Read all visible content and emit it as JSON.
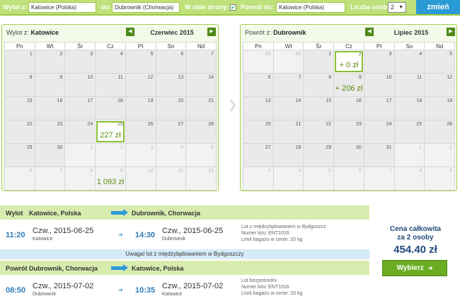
{
  "search": {
    "from_label": "Wylot z:",
    "from_value": "Katowice (Polska)",
    "to_label": "do:",
    "to_value": "Dubrownik (Chorwacja)",
    "roundtrip_label": "W obie strony:",
    "return_label": "Powrót do:",
    "return_value": "Katowice (Polska)",
    "persons_label": "Liczba osób:",
    "persons_value": "2",
    "submit_label": "zmień"
  },
  "outbound_calendar": {
    "title_prefix": "Wylot z:",
    "city": "Katowice",
    "month": "Czerwiec 2015",
    "weekdays": [
      "Pn",
      "Wt",
      "Śr",
      "Cz",
      "Pt",
      "So",
      "Nd"
    ],
    "weeks": [
      [
        {
          "d": "1"
        },
        {
          "d": "2"
        },
        {
          "d": "3"
        },
        {
          "d": "4"
        },
        {
          "d": "5"
        },
        {
          "d": "6"
        },
        {
          "d": "7"
        }
      ],
      [
        {
          "d": "8"
        },
        {
          "d": "9"
        },
        {
          "d": "10"
        },
        {
          "d": "11"
        },
        {
          "d": "12"
        },
        {
          "d": "13"
        },
        {
          "d": "14"
        }
      ],
      [
        {
          "d": "15"
        },
        {
          "d": "16"
        },
        {
          "d": "17"
        },
        {
          "d": "18"
        },
        {
          "d": "19"
        },
        {
          "d": "20"
        },
        {
          "d": "21"
        }
      ],
      [
        {
          "d": "22"
        },
        {
          "d": "23"
        },
        {
          "d": "24"
        },
        {
          "d": "25",
          "price": "227 zł",
          "sel": true
        },
        {
          "d": "26"
        },
        {
          "d": "27"
        },
        {
          "d": "28"
        }
      ],
      [
        {
          "d": "29"
        },
        {
          "d": "30"
        },
        {
          "d": "1",
          "out": true
        },
        {
          "d": "2",
          "out": true
        },
        {
          "d": "3",
          "out": true
        },
        {
          "d": "4",
          "out": true
        },
        {
          "d": "5",
          "out": true
        }
      ],
      [
        {
          "d": "6",
          "out": true
        },
        {
          "d": "7",
          "out": true
        },
        {
          "d": "8",
          "out": true
        },
        {
          "d": "9",
          "out": true,
          "price": "1 093 zł"
        },
        {
          "d": "10",
          "out": true
        },
        {
          "d": "11",
          "out": true
        },
        {
          "d": "12",
          "out": true
        }
      ]
    ]
  },
  "return_calendar": {
    "title_prefix": "Powrót z:",
    "city": "Dubrownik",
    "month": "Lipiec 2015",
    "weekdays": [
      "Pn",
      "Wt",
      "Śr",
      "Cz",
      "Pt",
      "So",
      "Nd"
    ],
    "weeks": [
      [
        {
          "d": "29",
          "out": true
        },
        {
          "d": "30",
          "out": true
        },
        {
          "d": "1"
        },
        {
          "d": "2",
          "price": "+ 0 zł",
          "sel": true
        },
        {
          "d": "3"
        },
        {
          "d": "4"
        },
        {
          "d": "5"
        }
      ],
      [
        {
          "d": "6"
        },
        {
          "d": "7"
        },
        {
          "d": "8"
        },
        {
          "d": "9",
          "price": "+ 206 zł"
        },
        {
          "d": "10"
        },
        {
          "d": "11"
        },
        {
          "d": "12"
        }
      ],
      [
        {
          "d": "13"
        },
        {
          "d": "14"
        },
        {
          "d": "15"
        },
        {
          "d": "16"
        },
        {
          "d": "17"
        },
        {
          "d": "18"
        },
        {
          "d": "19"
        }
      ],
      [
        {
          "d": "20"
        },
        {
          "d": "21"
        },
        {
          "d": "22"
        },
        {
          "d": "23"
        },
        {
          "d": "24"
        },
        {
          "d": "25"
        },
        {
          "d": "26"
        }
      ],
      [
        {
          "d": "27"
        },
        {
          "d": "28"
        },
        {
          "d": "29"
        },
        {
          "d": "30"
        },
        {
          "d": "31"
        },
        {
          "d": "1",
          "out": true
        },
        {
          "d": "2",
          "out": true
        }
      ],
      [
        {
          "d": "3",
          "out": true
        },
        {
          "d": "4",
          "out": true
        },
        {
          "d": "5",
          "out": true
        },
        {
          "d": "6",
          "out": true
        },
        {
          "d": "7",
          "out": true
        },
        {
          "d": "8",
          "out": true
        },
        {
          "d": "9",
          "out": true
        }
      ]
    ]
  },
  "outbound_flight": {
    "label": "Wylot",
    "from": "Katowice, Polska",
    "to": "Dubrownik, Chorwacja",
    "dep_time": "11:20",
    "dep_date": "Czw., 2015-06-25",
    "dep_city": "Katowice",
    "arr_time": "14:30",
    "arr_date": "Czw., 2015-06-25",
    "arr_city": "Dubrownik",
    "info_1": "Lot z międzylądowaniem w Bydgoszcz",
    "info_2": "Numer lotu: ENT1016",
    "info_3": "Limit bagażu w cenie: 20 kg"
  },
  "warning": "Uwaga! lot z międzylądowaniem w Bydgoszczy",
  "return_flight": {
    "label": "Powrót",
    "from": "Dubrownik, Chorwacja",
    "to": "Katowice, Polska",
    "dep_time": "08:50",
    "dep_date": "Czw., 2015-07-02",
    "dep_city": "Dubrownik",
    "arr_time": "10:35",
    "arr_date": "Czw., 2015-07-02",
    "arr_city": "Katowice",
    "info_1": "Lot bezpośredni",
    "info_2": "Numer lotu: ENT1016",
    "info_3": "Limit bagażu w cenie: 20 kg"
  },
  "price": {
    "label_1": "Cena całkowita",
    "label_2": "za 2 osoby",
    "total": "454.40 zł",
    "buy_label": "Wybierz"
  }
}
